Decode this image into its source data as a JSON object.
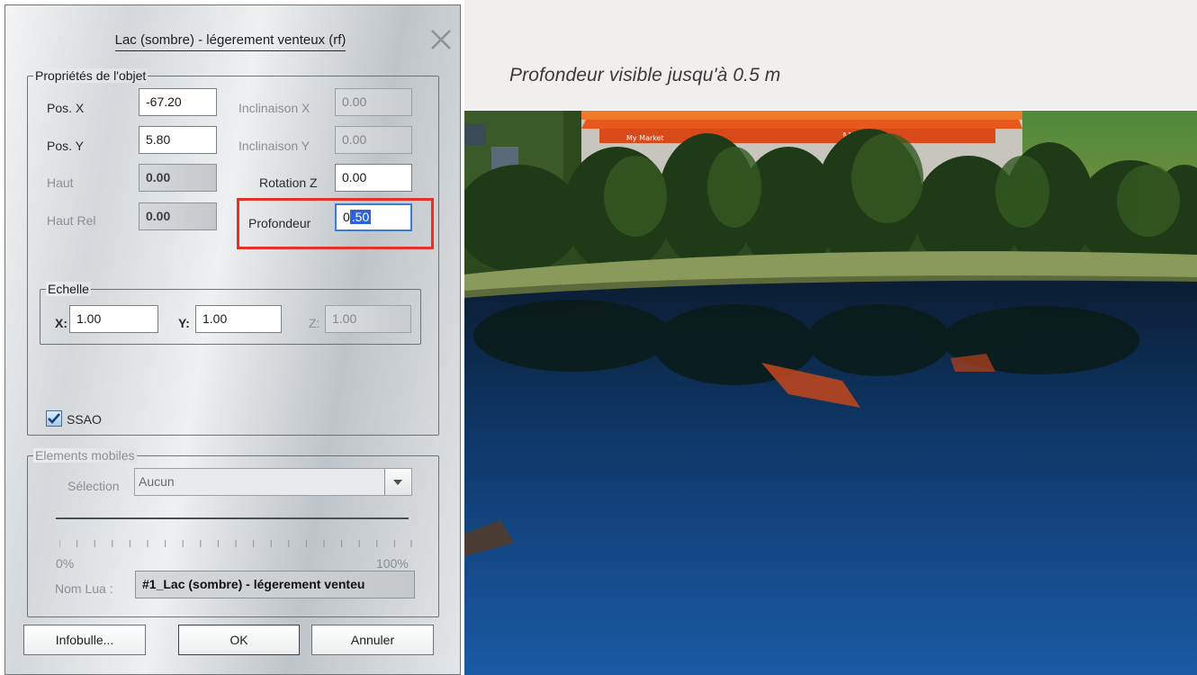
{
  "caption": "Profondeur visible jusqu'à 0.5 m",
  "dialog": {
    "title": "Lac (sombre) - légerement venteux (rf)",
    "properties_group": "Propriétés de l'objet",
    "pos_x_label": "Pos. X",
    "pos_x": "-67.20",
    "pos_y_label": "Pos. Y",
    "pos_y": "5.80",
    "haut_label": "Haut",
    "haut": "0.00",
    "haut_rel_label": "Haut Rel",
    "haut_rel": "0.00",
    "inclinaison_x_label": "Inclinaison X",
    "inclinaison_x": "0.00",
    "inclinaison_y_label": "Inclinaison Y",
    "inclinaison_y": "0.00",
    "rotation_z_label": "Rotation Z",
    "rotation_z": "0.00",
    "profondeur_label": "Profondeur",
    "profondeur_pre": "0",
    "profondeur_sel": ".50",
    "echelle_group": "Echelle",
    "scale_x_label": "X:",
    "scale_x": "1.00",
    "scale_y_label": "Y:",
    "scale_y": "1.00",
    "scale_z_label": "Z:",
    "scale_z": "1.00",
    "ssao_label": "SSAO",
    "ssao_checked": true,
    "elements_group": "Elements mobiles",
    "selection_label": "Sélection",
    "selection_value": "Aucun",
    "slider_min": "0%",
    "slider_max": "100%",
    "nom_lua_label": "Nom Lua :",
    "nom_lua_value": "#1_Lac (sombre) - légerement venteu",
    "btn_infobulle": "Infobulle...",
    "btn_ok": "OK",
    "btn_annuler": "Annuler"
  },
  "scene": {
    "market_sign_1": "My Market",
    "market_sign_2": "My M"
  },
  "colors": {
    "highlight_box": "#e2322a",
    "selection": "#2d62d8",
    "water": "#0d3d78"
  }
}
